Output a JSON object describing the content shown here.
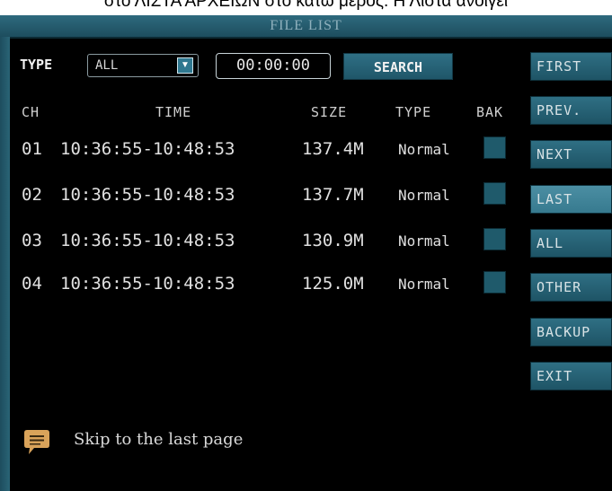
{
  "caption": "στο ΛΙΣΤΑ ΑΡΧΕΙΩΝ στο κάτω μέρος. Η Λίστα ανοίγει",
  "window": {
    "title": "FILE LIST"
  },
  "filter": {
    "type_label": "TYPE",
    "type_value": "ALL",
    "time_value": "00:00:00",
    "search_label": "SEARCH"
  },
  "columns": {
    "ch": "CH",
    "time": "TIME",
    "size": "SIZE",
    "type": "TYPE",
    "bak": "BAK"
  },
  "rows": [
    {
      "ch": "01",
      "time": "10:36:55-10:48:53",
      "size": "137.4M",
      "type": "Normal",
      "bak": false
    },
    {
      "ch": "02",
      "time": "10:36:55-10:48:53",
      "size": "137.7M",
      "type": "Normal",
      "bak": false
    },
    {
      "ch": "03",
      "time": "10:36:55-10:48:53",
      "size": "130.9M",
      "type": "Normal",
      "bak": false
    },
    {
      "ch": "04",
      "time": "10:36:55-10:48:53",
      "size": "125.0M",
      "type": "Normal",
      "bak": false
    }
  ],
  "side_buttons": [
    {
      "label": "FIRST",
      "active": false
    },
    {
      "label": "PREV.",
      "active": false
    },
    {
      "label": "NEXT",
      "active": false
    },
    {
      "label": "LAST",
      "active": true
    },
    {
      "label": "ALL",
      "active": false
    },
    {
      "label": "OTHER",
      "active": false
    },
    {
      "label": "BACKUP",
      "active": false
    },
    {
      "label": "EXIT",
      "active": false
    }
  ],
  "hint": {
    "icon": "message-icon",
    "text": "Skip to the last page"
  },
  "colors": {
    "background": "#000000",
    "accent": "#2f6f84",
    "active": "#4b8ea3",
    "hint_icon": "#d9a35a"
  }
}
